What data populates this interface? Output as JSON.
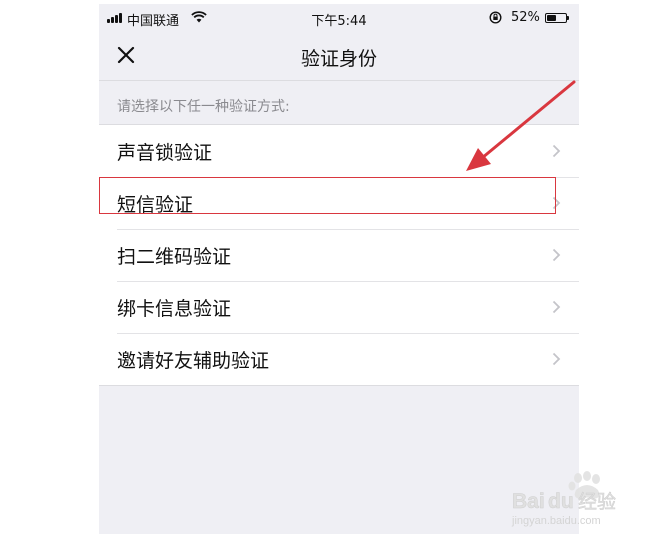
{
  "status_bar": {
    "carrier": "中国联通",
    "time": "下午5:44",
    "battery_percent": "52%",
    "battery_level": 0.52,
    "signal_icon": "signal-bars-icon",
    "wifi_icon": "wifi-icon",
    "rotation_lock_icon": "rotation-lock-icon"
  },
  "nav": {
    "title": "验证身份",
    "close_icon": "close-icon"
  },
  "section_hint": "请选择以下任一种验证方式:",
  "options": [
    {
      "label": "声音锁验证"
    },
    {
      "label": "短信验证"
    },
    {
      "label": "扫二维码验证"
    },
    {
      "label": "绑卡信息验证"
    },
    {
      "label": "邀请好友辅助验证"
    }
  ],
  "colors": {
    "background": "#efeff4",
    "list_background": "#ffffff",
    "annotation_red": "#d9373f",
    "secondary_text": "#8a8a8f"
  },
  "watermark": {
    "brand": "Baidu经验",
    "url": "jingyan.baidu.com"
  }
}
